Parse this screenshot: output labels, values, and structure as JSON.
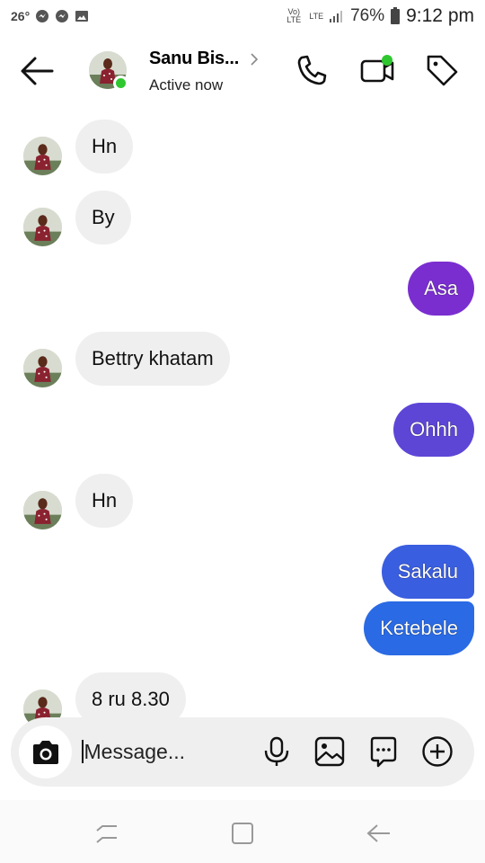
{
  "status_bar": {
    "temperature": "26°",
    "volte_label": "Vo) LTE",
    "lte_label": "LTE",
    "battery": "76%",
    "time": "9:12 pm"
  },
  "header": {
    "contact_name": "Sanu Bis...",
    "active_status": "Active now",
    "icons": [
      "back-arrow-icon",
      "chevron-right-icon",
      "phone-icon",
      "video-camera-icon",
      "tag-icon"
    ]
  },
  "messages": [
    {
      "direction": "in",
      "text": "Hn",
      "show_avatar": true
    },
    {
      "direction": "in",
      "text": "By",
      "show_avatar": true
    },
    {
      "direction": "out",
      "text": "Asa",
      "color": "#7a2ed0"
    },
    {
      "direction": "in",
      "text": "Bettry khatam",
      "show_avatar": true
    },
    {
      "direction": "out",
      "text": "Ohhh",
      "color": "#5d46d6"
    },
    {
      "direction": "in",
      "text": "Hn",
      "show_avatar": true
    },
    {
      "direction": "out",
      "text": "Sakalu",
      "color": "#3a5ee0"
    },
    {
      "direction": "out",
      "text": "Ketebele",
      "color": "#2a6ae4"
    },
    {
      "direction": "in",
      "text": "8  ru 8.30",
      "show_avatar": true
    }
  ],
  "composer": {
    "placeholder": "Message...",
    "icons": [
      "camera-icon",
      "microphone-icon",
      "gallery-icon",
      "sticker-icon",
      "plus-icon"
    ]
  },
  "nav_bar": {
    "icons": [
      "recent-apps-icon",
      "home-icon",
      "back-icon"
    ]
  },
  "colors": {
    "online": "#2fc72f",
    "incoming_bubble": "#efefef"
  }
}
